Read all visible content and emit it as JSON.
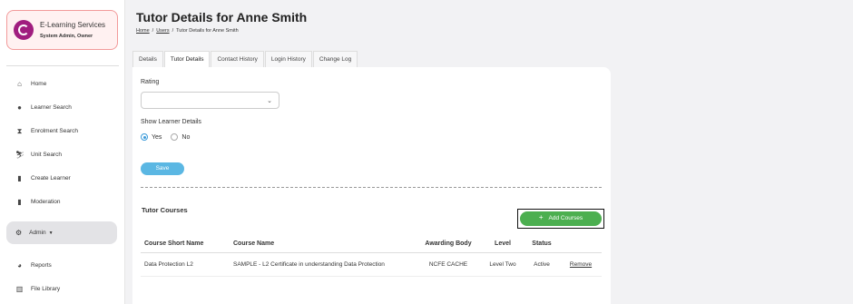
{
  "org": {
    "name": "E-Learning Services",
    "role": "System Admin, Owner"
  },
  "nav": {
    "items": [
      {
        "label": "Home",
        "icon": "home-icon"
      },
      {
        "label": "Learner Search",
        "icon": "user-icon"
      },
      {
        "label": "Enrolment Search",
        "icon": "hourglass-icon"
      },
      {
        "label": "Unit Search",
        "icon": "ski-icon"
      },
      {
        "label": "Create Learner",
        "icon": "clipboard-icon"
      },
      {
        "label": "Moderation",
        "icon": "clipboard-check-icon"
      }
    ],
    "admin": {
      "label": "Admin",
      "icon": "cogs-icon"
    },
    "bottom": [
      {
        "label": "Reports",
        "icon": "pie-chart-icon"
      },
      {
        "label": "File Library",
        "icon": "books-icon"
      }
    ]
  },
  "header": {
    "title": "Tutor Details for Anne Smith",
    "breadcrumb": [
      "Home",
      "Users",
      "Tutor Details for Anne Smith"
    ]
  },
  "tabs": [
    "Details",
    "Tutor Details",
    "Contact History",
    "Login History",
    "Change Log"
  ],
  "form": {
    "rating_label": "Rating",
    "rating_value": "",
    "show_details_label": "Show Learner Details",
    "options": [
      "Yes",
      "No"
    ],
    "selected": "Yes",
    "save_label": "Save"
  },
  "courses": {
    "title": "Tutor Courses",
    "add_label": "Add Courses",
    "columns": [
      "Course Short Name",
      "Course Name",
      "Awarding Body",
      "Level",
      "Status"
    ],
    "rows": [
      {
        "short_name": "Data Protection L2",
        "name": "SAMPLE - L2 Certificate in understanding Data Protection",
        "awarding_body": "NCFE CACHE",
        "level": "Level Two",
        "status": "Active",
        "action": "Remove"
      }
    ]
  },
  "colors": {
    "accent": "#5bb7e3",
    "success": "#4caf50",
    "brand": "#a01d7f"
  }
}
